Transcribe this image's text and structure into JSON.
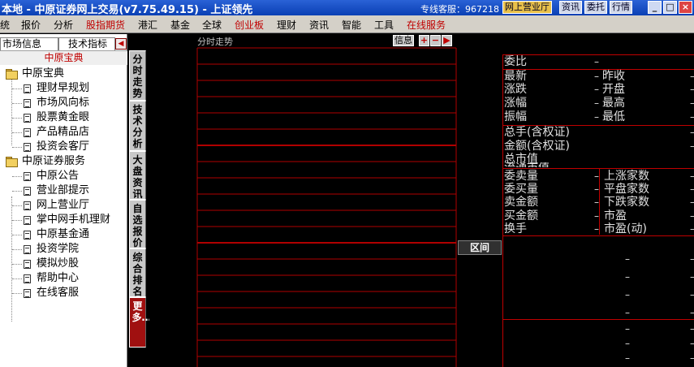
{
  "window": {
    "title": "本地 - 中原证券网上交易(v7.75.49.15) - 上证领先",
    "hotline": "专线客服：967218",
    "buttons": [
      "网上营业厅",
      "资讯",
      "委托",
      "行情"
    ],
    "controls": [
      "minimize-icon",
      "maximize-icon",
      "close-icon"
    ]
  },
  "menu": {
    "items": [
      {
        "label": "统",
        "red": false
      },
      {
        "label": "报价",
        "red": false
      },
      {
        "label": "分析",
        "red": false
      },
      {
        "label": "股指期货",
        "red": true
      },
      {
        "label": "港汇",
        "red": false
      },
      {
        "label": "基金",
        "red": false
      },
      {
        "label": "全球",
        "red": false
      },
      {
        "label": "创业板",
        "red": true
      },
      {
        "label": "理财",
        "red": false
      },
      {
        "label": "资讯",
        "red": false
      },
      {
        "label": "智能",
        "red": false
      },
      {
        "label": "工具",
        "red": false
      },
      {
        "label": "在线服务",
        "red": true
      }
    ]
  },
  "left_panel": {
    "tabs": [
      "市场信息",
      "技术指标"
    ],
    "header": "中原宝典",
    "tree": [
      {
        "label": "中原宝典",
        "type": "folder"
      },
      {
        "label": "理财早规划",
        "type": "doc"
      },
      {
        "label": "市场风向标",
        "type": "doc"
      },
      {
        "label": "股票黄金眼",
        "type": "doc"
      },
      {
        "label": "产品精品店",
        "type": "doc"
      },
      {
        "label": "投资会客厅",
        "type": "doc"
      },
      {
        "label": "中原证券服务",
        "type": "folder"
      },
      {
        "label": "中原公告",
        "type": "doc"
      },
      {
        "label": "营业部提示",
        "type": "doc"
      },
      {
        "label": "网上营业厅",
        "type": "doc"
      },
      {
        "label": "掌中网手机理财",
        "type": "doc"
      },
      {
        "label": "中原基金通",
        "type": "doc"
      },
      {
        "label": "投资学院",
        "type": "doc"
      },
      {
        "label": "模拟炒股",
        "type": "doc"
      },
      {
        "label": "帮助中心",
        "type": "doc"
      },
      {
        "label": "在线客服",
        "type": "doc"
      }
    ]
  },
  "vertical_tabs": [
    "分时走势",
    "技术分析",
    "大盘资讯",
    "自选报价",
    "综合排名",
    "更多…"
  ],
  "chart": {
    "title": "分时走势",
    "info_label": "信息",
    "icon_buttons": [
      "plus-icon",
      "minus-icon",
      "arrow-right-icon"
    ]
  },
  "interval_label": "区间",
  "quote": {
    "row1": "委比",
    "block1_left": [
      "最新",
      "涨跌",
      "涨幅",
      "振幅"
    ],
    "block1_right": [
      "昨收",
      "开盘",
      "最高",
      "最低"
    ],
    "block2": [
      "总手(含权证)",
      "金额(含权证)",
      "总市值",
      "流通市值"
    ],
    "block3_left": [
      "委卖量",
      "委买量",
      "卖金额",
      "买金额",
      "换手"
    ],
    "block3_right": [
      "上涨家数",
      "平盘家数",
      "下跌家数",
      "市盈",
      "市盈(动)"
    ],
    "dash": "–"
  },
  "colors": {
    "grid_red": "#b00000",
    "title_blue": "#0a3fb4",
    "hl_button": "#e8c04a"
  }
}
